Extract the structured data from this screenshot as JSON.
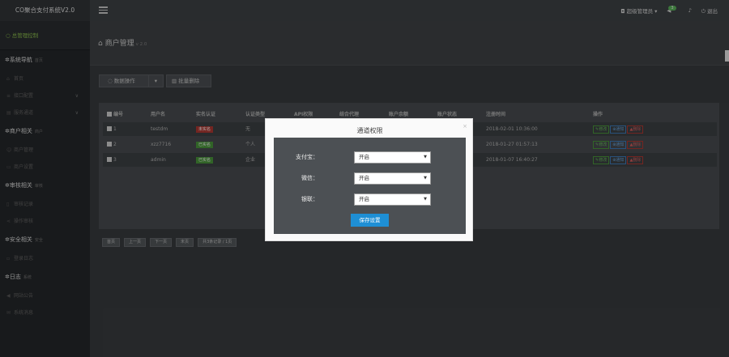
{
  "header": {
    "brand": "CO聚合支付系统V2.0",
    "user_menu": "超级管理员",
    "notify_count": "3",
    "logout": "退出"
  },
  "sidebar": {
    "active": "总管理控制",
    "sections": [
      {
        "title": "系统导航",
        "sub": "首页",
        "items": [
          {
            "label": "首页",
            "icon": "home-icon",
            "chevron": false
          },
          {
            "label": "接口配置",
            "icon": "sliders-icon",
            "chevron": true
          },
          {
            "label": "服务通道",
            "icon": "layers-icon",
            "chevron": true
          }
        ]
      },
      {
        "title": "商户相关",
        "sub": "商户",
        "items": [
          {
            "label": "商户管理",
            "icon": "user-icon",
            "chevron": false
          },
          {
            "label": "商户设置",
            "icon": "card-icon",
            "chevron": false
          }
        ]
      },
      {
        "title": "审核相关",
        "sub": "审核",
        "items": [
          {
            "label": "审核记录",
            "icon": "doc-icon",
            "chevron": false
          },
          {
            "label": "操作审核",
            "icon": "share-icon",
            "chevron": false
          }
        ]
      },
      {
        "title": "安全相关",
        "sub": "安全",
        "items": [
          {
            "label": "登录日志",
            "icon": "log-icon",
            "chevron": false
          }
        ]
      },
      {
        "title": "日志",
        "sub": "系统",
        "items": [
          {
            "label": "网站公告",
            "icon": "megaphone-icon",
            "chevron": false
          },
          {
            "label": "系统消息",
            "icon": "message-icon",
            "chevron": false
          }
        ]
      }
    ]
  },
  "page": {
    "title": "商户管理",
    "version": "v 2.0",
    "batch_button": "数据操作",
    "delete_button": "批量删除"
  },
  "table": {
    "headers": [
      "编号",
      "用户名",
      "实名认证",
      "认证类型",
      "API权限",
      "结合代理",
      "账户余额",
      "账户状态",
      "注册时间",
      "操作"
    ],
    "rows": [
      {
        "id": "1",
        "username": "testdm",
        "verify": "未实名",
        "verify_color": "red",
        "type": "无",
        "time": "2018-02-01 10:36:00"
      },
      {
        "id": "2",
        "username": "xzz7716",
        "verify": "已实名",
        "verify_color": "green",
        "type": "个人",
        "time": "2018-01-27 01:57:13"
      },
      {
        "id": "3",
        "username": "admin",
        "verify": "已实名",
        "verify_color": "green",
        "type": "企业",
        "time": "2018-01-07 16:40:27"
      }
    ],
    "actions": [
      "修改",
      "通知",
      "删除"
    ]
  },
  "pager": [
    "首页",
    "上一页",
    "下一页",
    "末页",
    "共3条记录 / 1页"
  ],
  "modal": {
    "title": "通道权限",
    "close": "×",
    "fields": [
      {
        "label": "支付宝：",
        "value": "开启"
      },
      {
        "label": "微信：",
        "value": "开启"
      },
      {
        "label": "银联：",
        "value": "开启"
      }
    ],
    "save": "保存设置"
  },
  "colors": {
    "accent_green": "#8fc34f",
    "save_blue": "#1e8fd5",
    "tag_red": "#b23a33",
    "tag_green": "#4c9a3d"
  }
}
